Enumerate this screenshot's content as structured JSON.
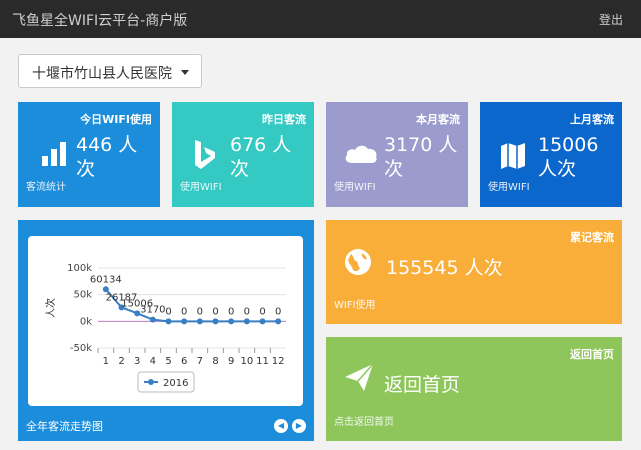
{
  "header": {
    "title": "飞鱼星全WIFI云平台-商户版",
    "logout_label": "登出"
  },
  "location_select": {
    "selected": "十堰市竹山县人民医院"
  },
  "tiles": [
    {
      "title": "今日WIFI使用",
      "value": "446 人次",
      "sub": "客流统计",
      "icon": "bar-chart-icon"
    },
    {
      "title": "昨日客流",
      "value": "676 人次",
      "sub": "使用WIFI",
      "icon": "bing-icon"
    },
    {
      "title": "本月客流",
      "value": "3170 人次",
      "sub": "使用WIFI",
      "icon": "cloud-icon"
    },
    {
      "title": "上月客流",
      "value": "15006 人次",
      "sub": "使用WIFI",
      "icon": "map-icon"
    },
    {
      "title": "累记客流",
      "value": "155545 人次",
      "sub": "WIFI使用",
      "icon": "globe-icon"
    },
    {
      "title": "返回首页",
      "value": "返回首页",
      "sub": "点击返回首页",
      "icon": "paper-plane-icon"
    }
  ],
  "chart_panel": {
    "footer": "全年客流走势图"
  },
  "colors": {
    "tile_blue": "#1c8ddb",
    "tile_teal": "#34c9c2",
    "tile_purple": "#9b9bcd",
    "tile_dark_blue": "#0c67cc",
    "tile_orange": "#f9ae3a",
    "tile_green": "#8fc65c",
    "series": "#3a7fc4"
  },
  "chart_data": {
    "type": "line",
    "x": [
      1,
      2,
      3,
      4,
      5,
      6,
      7,
      8,
      9,
      10,
      11,
      12
    ],
    "series": [
      {
        "name": "2016",
        "values": [
          60134,
          26187,
          15006,
          3170,
          0,
          0,
          0,
          0,
          0,
          0,
          0,
          0
        ]
      }
    ],
    "ylabel": "人次",
    "ylim": [
      -50000,
      100000
    ],
    "y_ticks": [
      "100k",
      "50k",
      "0k",
      "-50k"
    ],
    "x_ticks": [
      "1",
      "2",
      "3",
      "4",
      "5",
      "6",
      "7",
      "8",
      "9",
      "10",
      "11",
      "12"
    ],
    "data_labels": [
      "60134",
      "26187",
      "15006",
      "3170",
      "0",
      "0",
      "0",
      "0",
      "0",
      "0",
      "0",
      "0"
    ],
    "grid": true,
    "legend": "bottom-center"
  }
}
